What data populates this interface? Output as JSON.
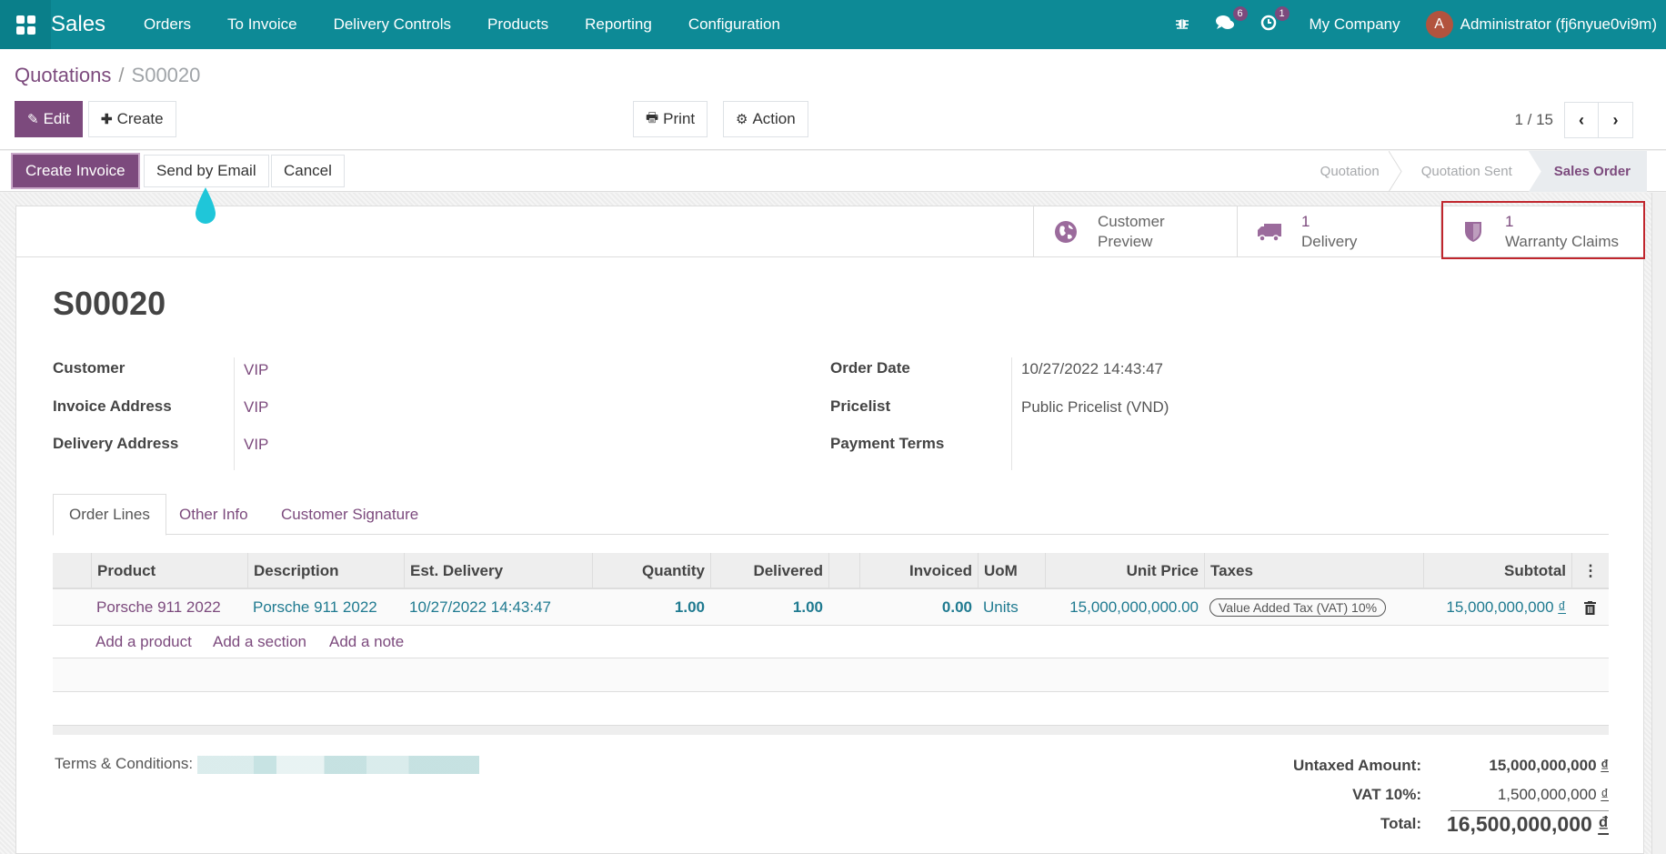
{
  "navbar": {
    "app_name": "Sales",
    "menu": [
      "Orders",
      "To Invoice",
      "Delivery Controls",
      "Products",
      "Reporting",
      "Configuration"
    ],
    "messages_badge": "6",
    "activities_badge": "1",
    "company": "My Company",
    "user_initial": "A",
    "user_name": "Administrator (fj6nyue0vi9m)"
  },
  "breadcrumb": {
    "parent": "Quotations",
    "separator": "/",
    "current": "S00020"
  },
  "toolbar": {
    "edit": "Edit",
    "create": "Create",
    "print": "Print",
    "action": "Action"
  },
  "pager": {
    "value": "1 / 15"
  },
  "statusbar": {
    "create_invoice": "Create Invoice",
    "send_by_email": "Send by Email",
    "cancel": "Cancel",
    "stages": [
      "Quotation",
      "Quotation Sent",
      "Sales Order"
    ],
    "active_stage": "Sales Order"
  },
  "smart_buttons": {
    "customer_preview": [
      "Customer",
      "Preview"
    ],
    "delivery": {
      "count": "1",
      "label": "Delivery"
    },
    "warranty": {
      "count": "1",
      "label": "Warranty Claims"
    }
  },
  "record": {
    "name": "S00020",
    "customer_label": "Customer",
    "customer": "VIP",
    "invoice_address_label": "Invoice Address",
    "invoice_address": "VIP",
    "delivery_address_label": "Delivery Address",
    "delivery_address": "VIP",
    "order_date_label": "Order Date",
    "order_date": "10/27/2022 14:43:47",
    "pricelist_label": "Pricelist",
    "pricelist": "Public Pricelist (VND)",
    "payment_terms_label": "Payment Terms",
    "payment_terms": ""
  },
  "tabs": [
    "Order Lines",
    "Other Info",
    "Customer Signature"
  ],
  "order_lines": {
    "columns": [
      "Product",
      "Description",
      "Est. Delivery",
      "Quantity",
      "Delivered",
      "Invoiced",
      "UoM",
      "Unit Price",
      "Taxes",
      "Subtotal"
    ],
    "rows": [
      {
        "product": "Porsche 911 2022",
        "description": "Porsche 911 2022",
        "est_delivery": "10/27/2022 14:43:47",
        "quantity": "1.00",
        "delivered": "1.00",
        "invoiced": "0.00",
        "uom": "Units",
        "unit_price": "15,000,000,000.00",
        "taxes": "Value Added Tax (VAT) 10%",
        "subtotal": "15,000,000,000",
        "currency": "₫"
      }
    ],
    "add_product": "Add a product",
    "add_section": "Add a section",
    "add_note": "Add a note"
  },
  "terms_label": "Terms & Conditions:",
  "totals": {
    "untaxed_label": "Untaxed Amount:",
    "untaxed": "15,000,000,000",
    "vat_label": "VAT 10%:",
    "vat": "1,500,000,000",
    "total_label": "Total:",
    "total": "16,500,000,000",
    "currency": "₫"
  },
  "colors": {
    "navbar": "#0d8a96",
    "primary": "#7c4a7d",
    "link_teal": "#1f7a90",
    "highlight": "#c0262d"
  }
}
